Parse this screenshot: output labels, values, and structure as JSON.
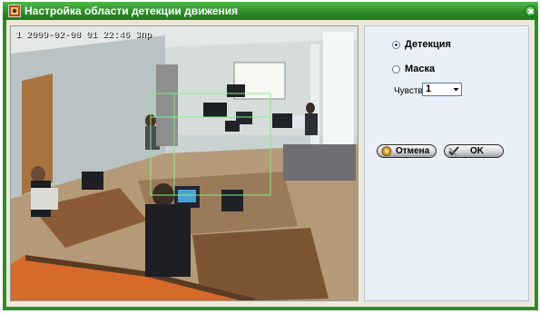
{
  "window": {
    "title": "Настройка области детекции движения"
  },
  "video": {
    "timestamp": "1 2009-02-08 01 22:46 3пр"
  },
  "panel": {
    "mode_options": [
      {
        "label": "Детекция",
        "checked": true
      },
      {
        "label": "Маска",
        "checked": false
      }
    ],
    "sensitivity": {
      "label": "Чувств:",
      "value": "1"
    },
    "buttons": {
      "cancel": "Отмена",
      "ok": "OK"
    }
  },
  "colors": {
    "titlebar": "#2b8a27",
    "panel_bg": "#eaf0f8",
    "client_bg": "#ece9d8",
    "detection_zone": "#7cf27c"
  }
}
